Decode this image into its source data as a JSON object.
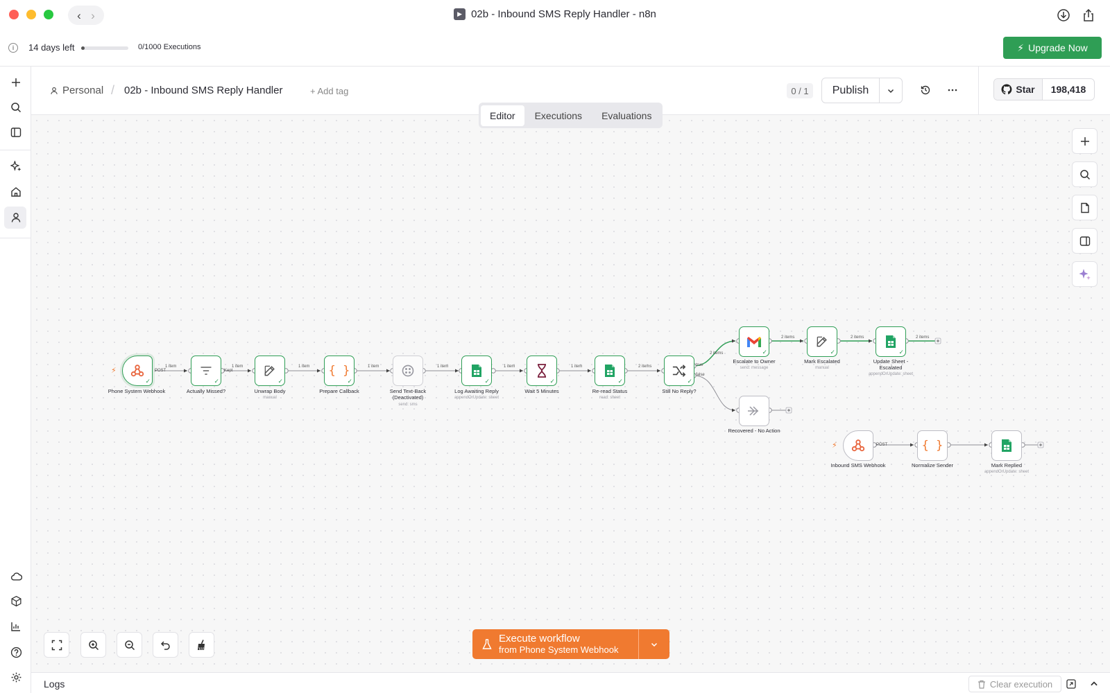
{
  "window": {
    "title": "02b - Inbound SMS Reply Handler - n8n"
  },
  "trial": {
    "days_left": "14 days left",
    "executions_label": "0/1000 Executions",
    "executions_used": 0,
    "executions_total": 1000,
    "upgrade_label": "Upgrade Now"
  },
  "breadcrumb": {
    "project": "Personal",
    "separator": "/",
    "workflow": "02b - Inbound SMS Reply Handler",
    "add_tag": "+ Add tag"
  },
  "header": {
    "version": "0 / 1",
    "publish_label": "Publish",
    "github_star": "Star",
    "github_count": "198,418"
  },
  "tabs": [
    {
      "label": "Editor",
      "active": true
    },
    {
      "label": "Executions",
      "active": false
    },
    {
      "label": "Evaluations",
      "active": false
    }
  ],
  "execute": {
    "label": "Execute workflow",
    "sublabel": "from Phone System Webhook"
  },
  "logs": {
    "label": "Logs",
    "clear_label": "Clear execution"
  },
  "colors": {
    "accent": "#f07a30",
    "success": "#2e9e55",
    "upgrade": "#2f9e55"
  },
  "nodes": {
    "phone_webhook": {
      "label": "Phone System Webhook",
      "icon": "webhook-icon"
    },
    "actually_missed": {
      "label": "Actually Missed?",
      "icon": "filter-icon"
    },
    "unwrap_body": {
      "label": "Unwrap Body",
      "sub": "manual",
      "icon": "edit-icon"
    },
    "prepare_callback": {
      "label": "Prepare Callback",
      "icon": "code-icon"
    },
    "send_textback": {
      "label": "Send Text-Back (Deactivated)",
      "sub": "send: sms",
      "icon": "twilio-icon"
    },
    "log_awaiting": {
      "label": "Log Awaiting Reply",
      "sub": "appendOrUpdate: sheet",
      "icon": "sheets-icon"
    },
    "wait_5": {
      "label": "Wait 5 Minutes",
      "icon": "hourglass-icon"
    },
    "reread_status": {
      "label": "Re-read Status",
      "sub": "read: sheet",
      "icon": "sheets-icon"
    },
    "still_no_reply": {
      "label": "Still No Reply?",
      "icon": "if-icon"
    },
    "escalate_owner": {
      "label": "Escalate to Owner",
      "sub": "send: message",
      "icon": "gmail-icon"
    },
    "mark_escalated": {
      "label": "Mark Escalated",
      "sub": "manual",
      "icon": "edit-icon"
    },
    "update_sheet": {
      "label": "Update Sheet - Escalated",
      "sub": "appendOrUpdate: sheet",
      "icon": "sheets-icon"
    },
    "recovered": {
      "label": "Recovered - No Action",
      "icon": "noop-icon"
    },
    "inbound_webhook": {
      "label": "Inbound SMS Webhook",
      "icon": "webhook-icon"
    },
    "normalize_sender": {
      "label": "Normalize Sender",
      "icon": "code-icon"
    },
    "mark_replied": {
      "label": "Mark Replied",
      "sub": "appendOrUpdate: sheet",
      "icon": "sheets-icon"
    }
  },
  "edges": {
    "post": "POST",
    "one_item": "1 item",
    "two_items": "2 items",
    "kept": "Kept",
    "true": "true",
    "false": "false"
  }
}
